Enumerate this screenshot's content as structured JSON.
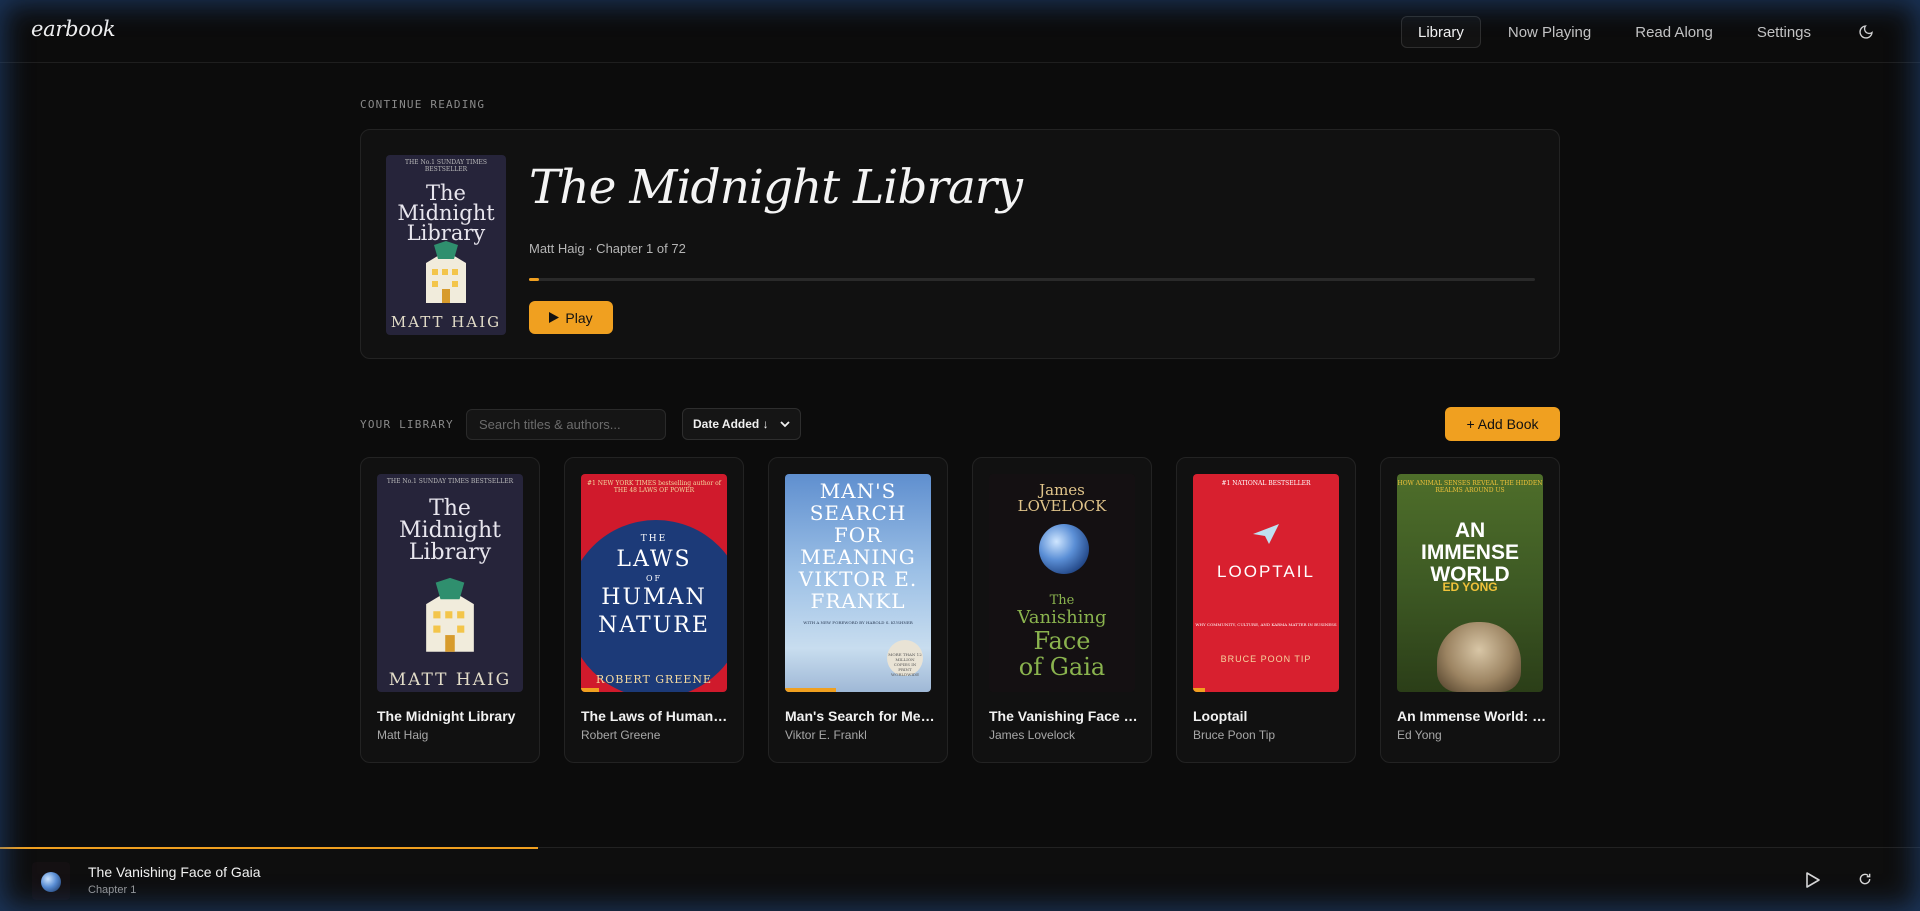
{
  "app": {
    "logo": "earbook"
  },
  "nav": {
    "items": [
      {
        "label": "Library",
        "active": true
      },
      {
        "label": "Now Playing",
        "active": false
      },
      {
        "label": "Read Along",
        "active": false
      },
      {
        "label": "Settings",
        "active": false
      }
    ],
    "theme_icon": "moon-icon"
  },
  "continue_reading": {
    "section_label": "CONTINUE READING",
    "title": "The Midnight Library",
    "meta": "Matt Haig · Chapter 1 of 72",
    "progress": 0.01,
    "play_label": "Play",
    "cover": {
      "blurb": "THE No.1 SUNDAY TIMES BESTSELLER",
      "title_lines": [
        "The",
        "Midnight",
        "Library"
      ],
      "author": "MATT HAIG"
    }
  },
  "library": {
    "section_label": "YOUR LIBRARY",
    "search_placeholder": "Search titles & authors...",
    "sort_label": "Date Added ↓",
    "add_label": "+ Add Book",
    "books": [
      {
        "title": "The Midnight Library",
        "author": "Matt Haig",
        "progress": 0.0,
        "cover": {
          "style": "ml",
          "top": "THE No.1 SUNDAY TIMES BESTSELLER",
          "lines": [
            "The",
            "Midnight",
            "Library"
          ],
          "author": "MATT HAIG"
        }
      },
      {
        "title": "The Laws of Human Nature",
        "author": "Robert Greene",
        "progress": 0.12,
        "cover": {
          "style": "laws",
          "top": "#1 NEW YORK TIMES bestselling author of THE 48 LAWS OF POWER",
          "lines": [
            "THE",
            "LAWS",
            "OF",
            "HUMAN",
            "NATURE"
          ],
          "author": "ROBERT GREENE"
        }
      },
      {
        "title": "Man's Search for Meaning",
        "author": "Viktor E. Frankl",
        "progress": 0.35,
        "cover": {
          "style": "man",
          "lines": [
            "MAN'S",
            "SEARCH",
            "FOR",
            "MEANING",
            "VIKTOR E.",
            "FRANKL"
          ],
          "sub": "WITH A NEW FOREWORD BY HAROLD S. KUSHNER",
          "seal": "MORE THAN 12 MILLION COPIES IN PRINT WORLDWIDE"
        }
      },
      {
        "title": "The Vanishing Face of Gaia",
        "author": "James Lovelock",
        "progress": 0.0,
        "cover": {
          "style": "gaia",
          "author_lines": [
            "James",
            "LOVELOCK"
          ],
          "lines": [
            "The",
            "Vanishing",
            "Face",
            "of Gaia"
          ]
        }
      },
      {
        "title": "Looptail",
        "author": "Bruce Poon Tip",
        "progress": 0.08,
        "cover": {
          "style": "loop",
          "top": "#1 NATIONAL BESTSELLER",
          "lines": [
            "LOOPTAIL"
          ],
          "sub": "WHY COMMUNITY, CULTURE, AND KARMA MATTER IN BUSINESS",
          "author": "BRUCE POON TIP"
        }
      },
      {
        "title": "An Immense World: How Animal Senses Reveal the Hidden Realms Around Us",
        "author": "Ed Yong",
        "progress": 0.0,
        "cover": {
          "style": "world",
          "top": "HOW ANIMAL SENSES REVEAL THE HIDDEN REALMS AROUND US",
          "lines": [
            "AN",
            "IMMENSE",
            "WORLD"
          ],
          "author": "ED YONG"
        }
      }
    ]
  },
  "player": {
    "title": "The Vanishing Face of Gaia",
    "chapter": "Chapter 1",
    "progress": 0.28,
    "play_icon": "play-icon",
    "refresh_icon": "refresh-icon"
  },
  "colors": {
    "accent": "#f0a020",
    "background": "#0c0c0c",
    "card": "#111111"
  }
}
